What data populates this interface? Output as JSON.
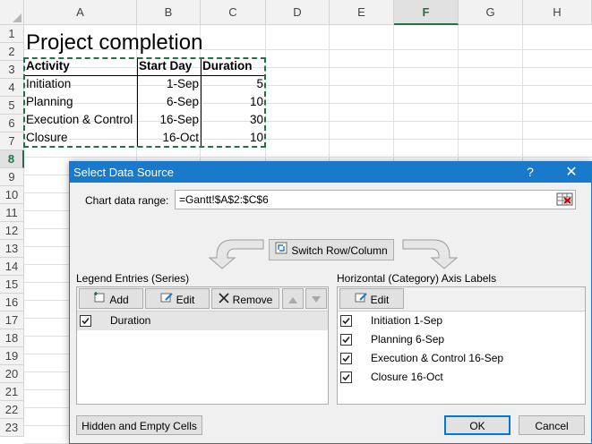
{
  "sheet": {
    "columns": [
      "A",
      "B",
      "C",
      "D",
      "E",
      "F",
      "G",
      "H"
    ],
    "selected_column": "F",
    "rows": [
      "1",
      "2",
      "3",
      "4",
      "5",
      "6",
      "7",
      "8",
      "9",
      "10",
      "11",
      "12",
      "13",
      "14",
      "15",
      "16",
      "17",
      "18",
      "19",
      "20",
      "21",
      "22",
      "23"
    ],
    "selected_row": "8",
    "title": "Project completion",
    "headers": [
      "Activity",
      "Start Day",
      "Duration"
    ],
    "data": [
      [
        "Initiation",
        "1-Sep",
        "5"
      ],
      [
        "Planning",
        "6-Sep",
        "10"
      ],
      [
        "Execution & Control",
        "16-Sep",
        "30"
      ],
      [
        "Closure",
        "16-Oct",
        "10"
      ]
    ]
  },
  "dialog": {
    "title": "Select Data Source",
    "help": "?",
    "close": "✕",
    "range_label": "Chart data range:",
    "range_value": "=Gantt!$A$2:$C$6",
    "switch_button": "Switch Row/Column",
    "legend_label": "Legend Entries (Series)",
    "add_button": "Add",
    "edit_button": "Edit",
    "remove_button": "Remove",
    "series": [
      {
        "label": "Duration",
        "checked": true
      }
    ],
    "axis_label": "Horizontal (Category) Axis Labels",
    "axis_edit_button": "Edit",
    "categories": [
      {
        "label": "Initiation 1-Sep",
        "checked": true
      },
      {
        "label": "Planning 6-Sep",
        "checked": true
      },
      {
        "label": "Execution & Control 16-Sep",
        "checked": true
      },
      {
        "label": "Closure 16-Oct",
        "checked": true
      }
    ],
    "hidden_cells_button": "Hidden and Empty Cells",
    "ok_button": "OK",
    "cancel_button": "Cancel"
  },
  "colors": {
    "excel_green": "#217346",
    "title_blue": "#1979ca",
    "dialog_bg": "#f0f0f0"
  }
}
